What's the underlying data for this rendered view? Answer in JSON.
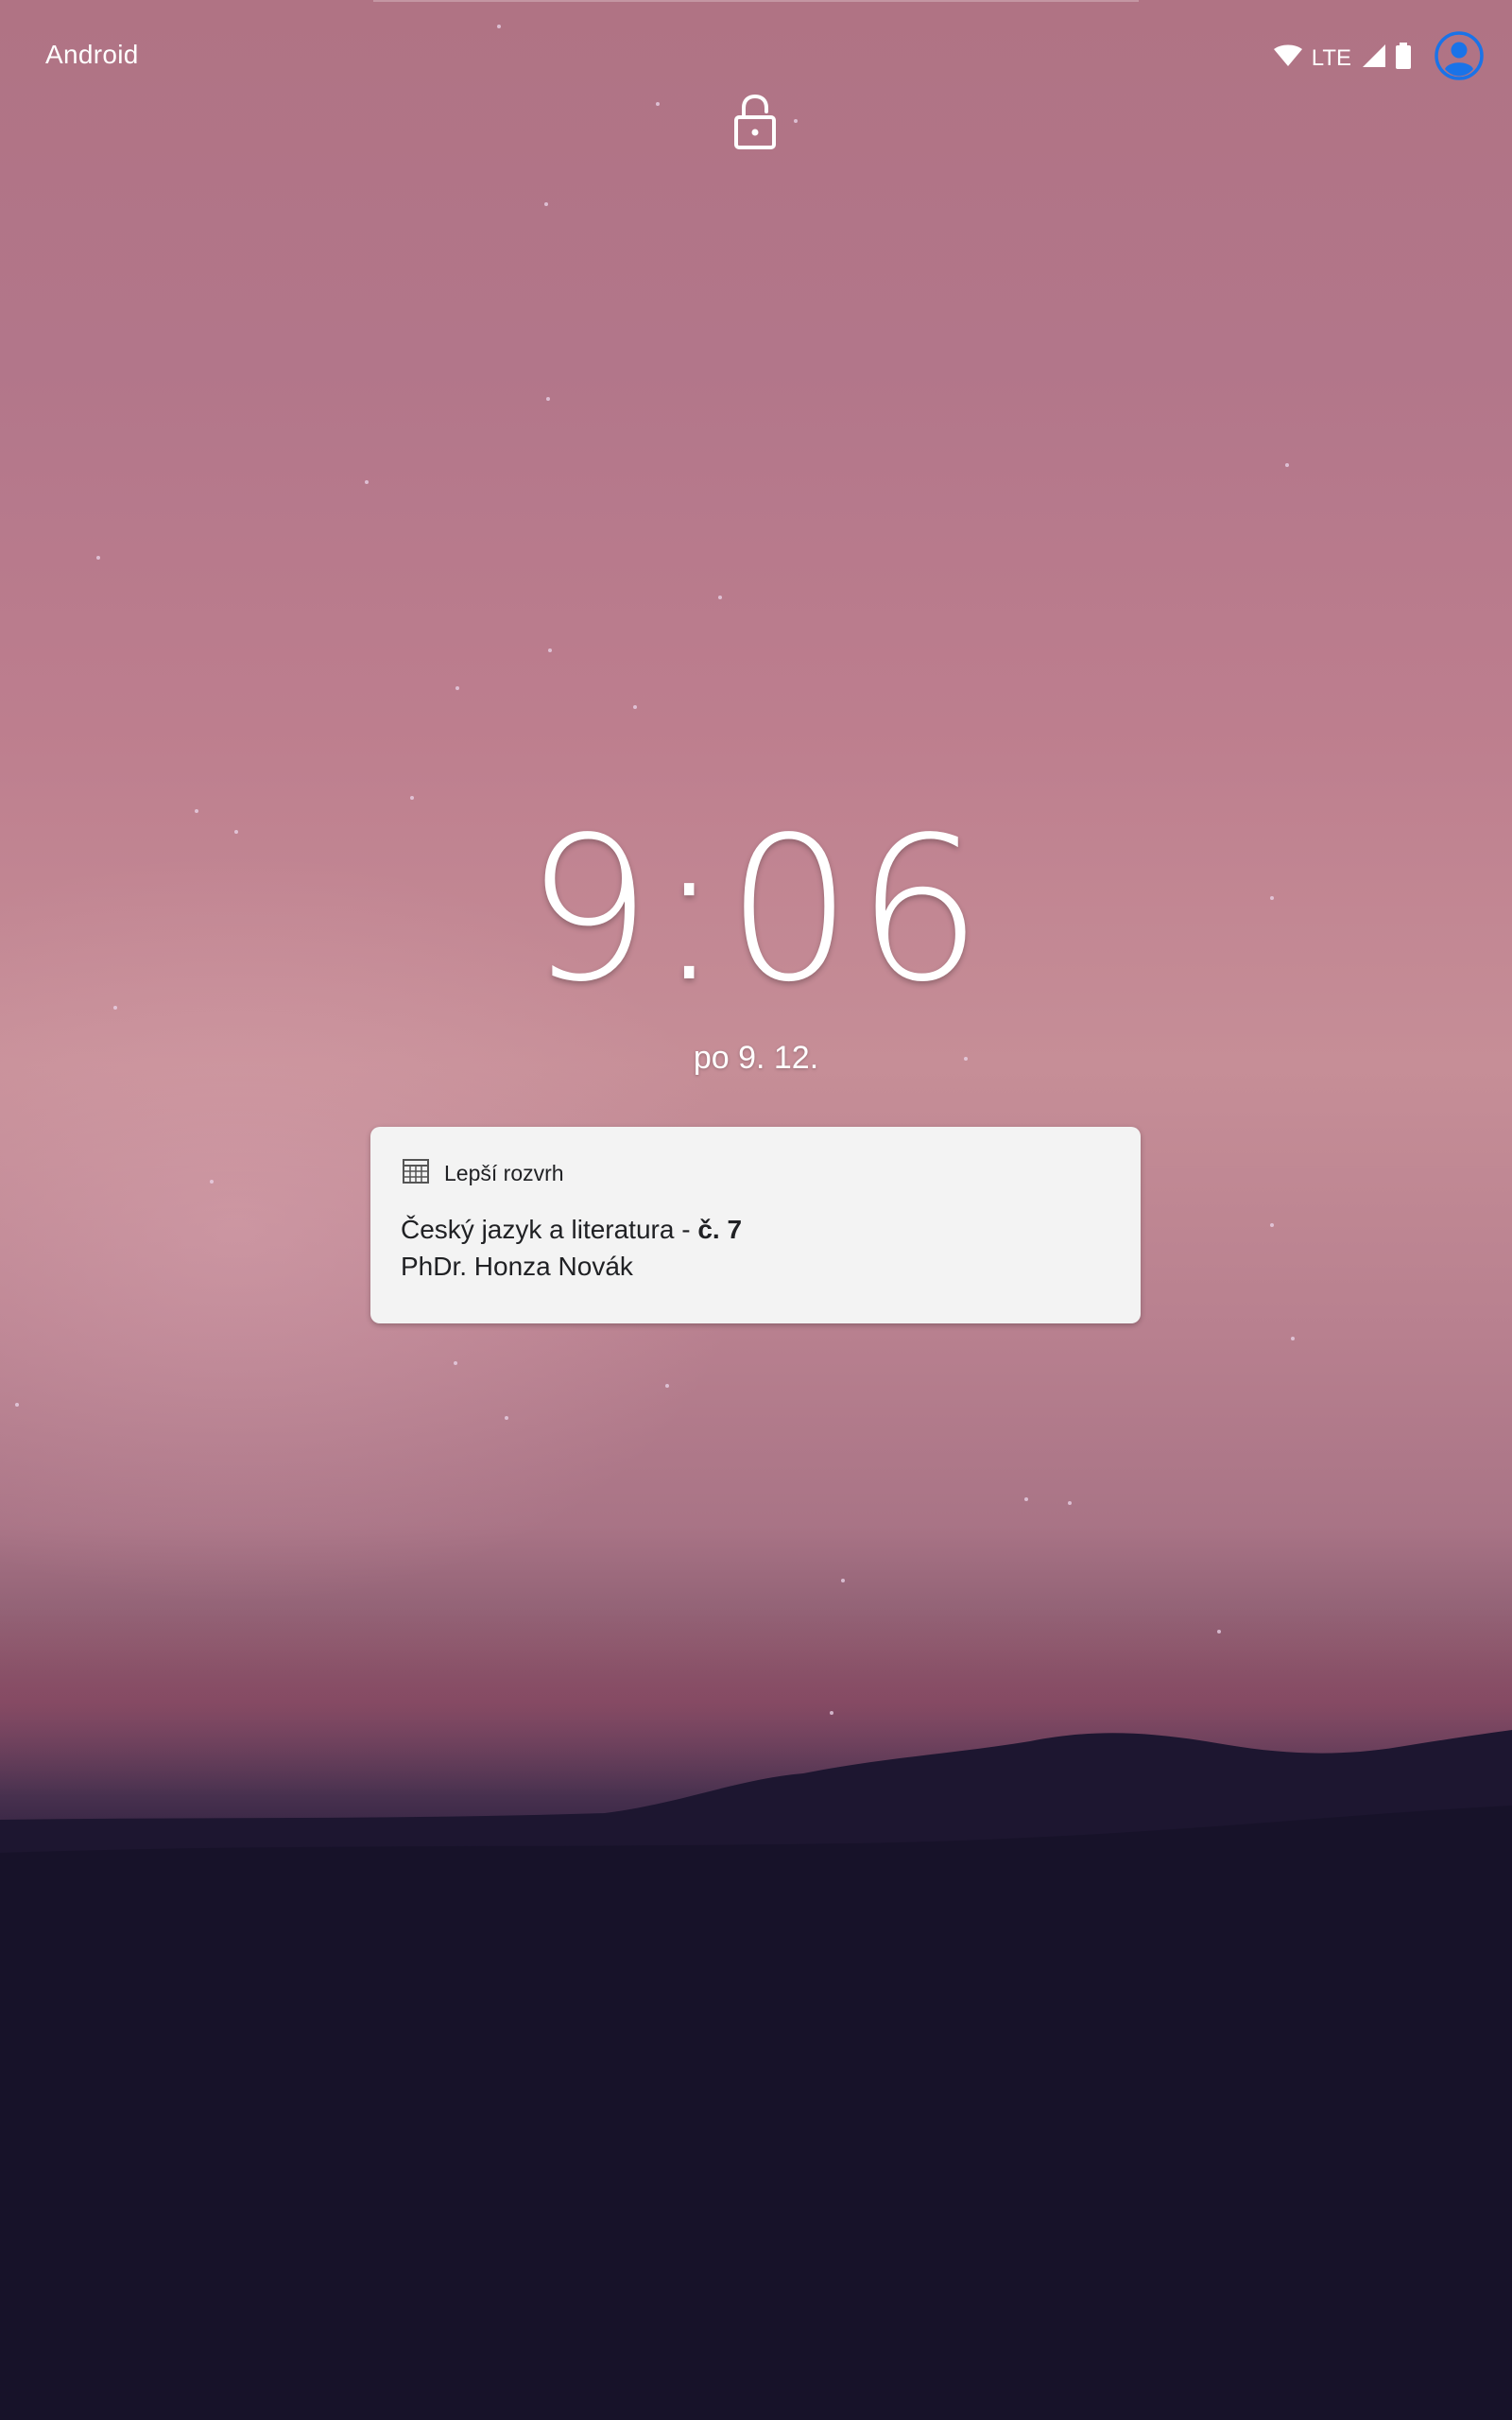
{
  "status_bar": {
    "carrier": "Android",
    "network": "LTE",
    "icons": [
      "wifi-icon",
      "cell-signal-icon",
      "battery-icon",
      "user-avatar-icon"
    ]
  },
  "lockscreen": {
    "lock_icon": "lock-icon",
    "time": "9:06",
    "date": "po 9. 12."
  },
  "notification": {
    "app_icon": "grid-calendar-icon",
    "app_name": "Lepší rozvrh",
    "title_prefix": "Český jazyk a literatura - ",
    "title_bold": "č. 7",
    "text": "PhDr. Honza Novák"
  },
  "colors": {
    "accent_avatar": "#1a73e8",
    "card_background": "#f3f3f3",
    "sky_top": "#b07384",
    "ground": "#131025"
  }
}
